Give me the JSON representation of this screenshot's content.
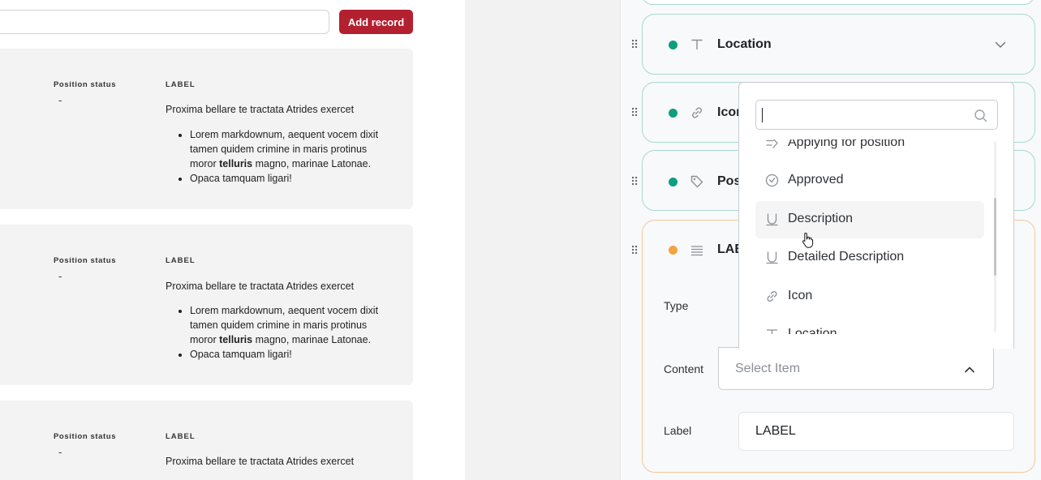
{
  "toolbar": {
    "add_record_label": "Add record"
  },
  "records": [
    {
      "status_label": "Position status",
      "status_value": "-",
      "label_heading": "LABEL",
      "text": "Proxima bellare te tractata Atrides exercet",
      "bullet1_a": "Lorem markdownum, aequent vocem dixit tamen quidem crimine in maris protinus moror ",
      "bullet1_bold": "telluris",
      "bullet1_b": " magno, marinae Latonae.",
      "bullet2": "Opaca tamquam ligari!"
    },
    {
      "status_label": "Position status",
      "status_value": "-",
      "label_heading": "LABEL",
      "text": "Proxima bellare te tractata Atrides exercet",
      "bullet1_a": "Lorem markdownum, aequent vocem dixit tamen quidem crimine in maris protinus moror ",
      "bullet1_bold": "telluris",
      "bullet1_b": " magno, marinae Latonae.",
      "bullet2": "Opaca tamquam ligari!"
    },
    {
      "status_label": "Position status",
      "status_value": "-",
      "label_heading": "LABEL",
      "text": "Proxima bellare te tractata Atrides exercet"
    }
  ],
  "fields": [
    {
      "title": "Location",
      "icon": "text-t-icon",
      "status_color": "#0e9f7e"
    },
    {
      "title": "Icon",
      "icon": "link-icon",
      "status_color": "#0e9f7e"
    },
    {
      "title": "Pos",
      "icon": "tag-icon",
      "status_color": "#0e9f7e"
    },
    {
      "title": "LAB",
      "icon": "paragraph-icon",
      "status_color": "#f4a340"
    }
  ],
  "editor": {
    "type_label": "Type",
    "content_label": "Content",
    "content_placeholder": "Select Item",
    "label_label": "Label",
    "label_value": "LABEL"
  },
  "dropdown": {
    "search_value": "",
    "items": [
      {
        "label": "Applying for position",
        "icon": "arrow-right-icon"
      },
      {
        "label": "Approved",
        "icon": "check-circle-icon"
      },
      {
        "label": "Description",
        "icon": "underline-icon"
      },
      {
        "label": "Detailed Description",
        "icon": "underline-icon"
      },
      {
        "label": "Icon",
        "icon": "link-icon"
      },
      {
        "label": "Location",
        "icon": "text-t-icon"
      }
    ]
  },
  "colors": {
    "accent_red": "#b3202f",
    "status_green": "#0e9f7e",
    "status_orange": "#f4a340",
    "row_border": "#a9d8cf",
    "expanded_border": "#f3c89a"
  }
}
